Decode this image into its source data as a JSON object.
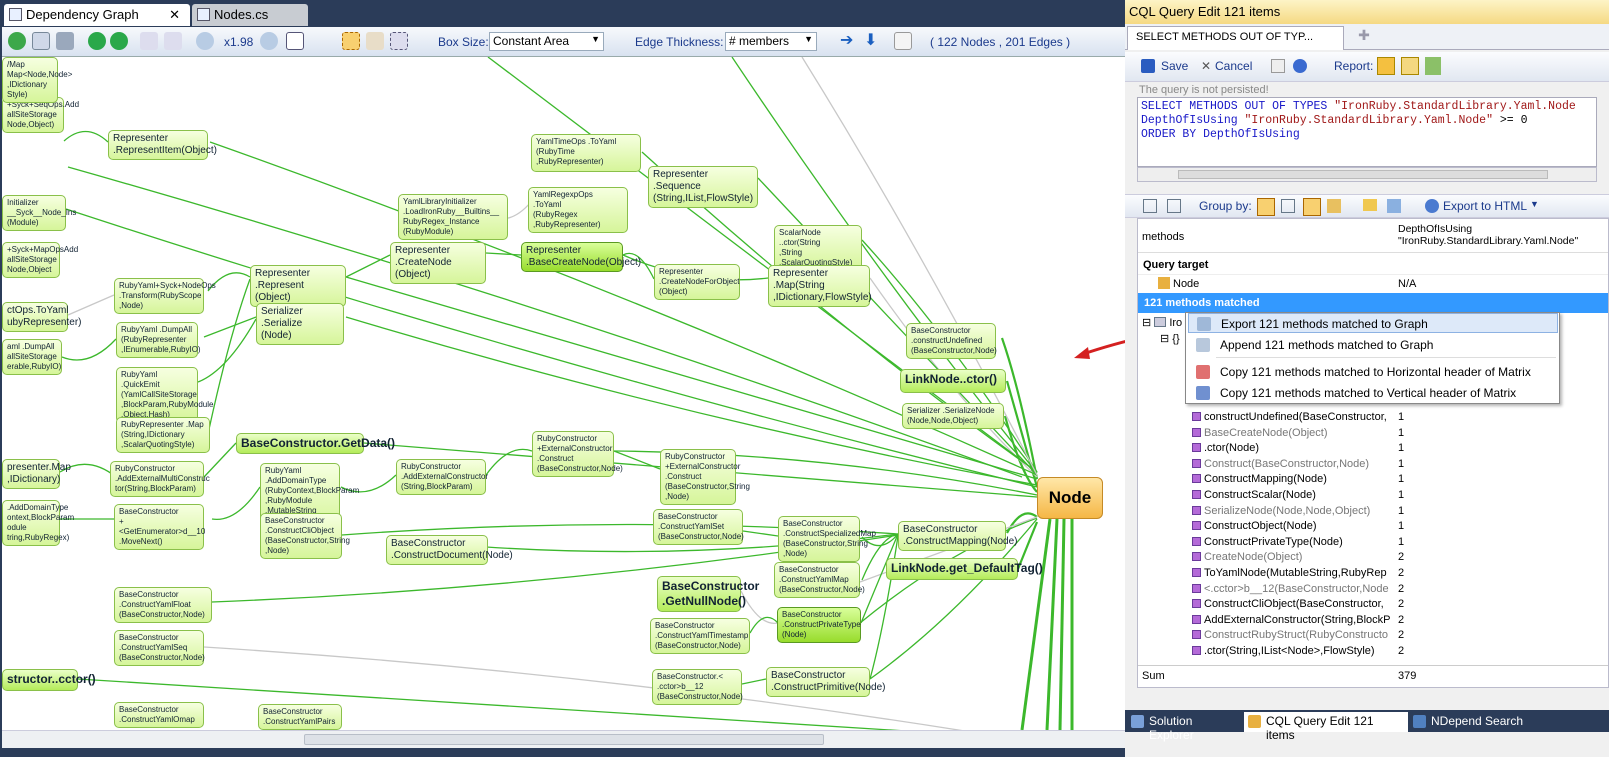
{
  "doc_tabs": {
    "graph": "Dependency Graph",
    "nodes": "Nodes.cs",
    "close": "✕"
  },
  "toolbar": {
    "zoom": "x1.98",
    "box_size_label": "Box Size:",
    "box_size_value": "Constant Area",
    "edge_thickness_label": "Edge Thickness:",
    "edge_thickness_value": "# members",
    "stats": "( 122 Nodes , 201 Edges )"
  },
  "graph": {
    "target_node": "Node",
    "nodes": [
      {
        "label": "Representer\n.RepresentItem(Object)",
        "cls": "mid"
      },
      {
        "label": "YamlTimeOps .ToYaml\n(RubyTime\n,RubyRepresenter)"
      },
      {
        "label": "Representer .Sequence\n(String,IList,FlowStyle)",
        "cls": "mid"
      },
      {
        "label": "YamlRegexpOps .ToYaml\n(RubyRegex\n,RubyRepresenter)"
      },
      {
        "label": "YamlLibraryInitializer\n.LoadIronRuby__Builtins__\nRubyRegex_Instance\n(RubyModule)"
      },
      {
        "label": "ScalarNode ..ctor(String\n,String\n,ScalarQuotingStyle)"
      },
      {
        "label": "Representer .CreateNode\n(Object)",
        "cls": "mid"
      },
      {
        "label": "Representer\n.BaseCreateNode(Object)",
        "cls": "mid sel"
      },
      {
        "label": "Representer\n.CreateNodeForObject\n(Object)"
      },
      {
        "label": "Representer .Map(String\n,IDictionary,FlowStyle)",
        "cls": "mid"
      },
      {
        "label": "Representer .Represent\n(Object)",
        "cls": "mid"
      },
      {
        "label": "RubyYaml+Syck+NodeOps\n.Transform(RubyScope\n,Node)"
      },
      {
        "label": "Serializer .Serialize\n(Node)",
        "cls": "mid"
      },
      {
        "label": "RubyYaml .DumpAll\n(RubyRepresenter\n,IEnumerable,RubyIO)"
      },
      {
        "label": "BaseConstructor\n.constructUndefined\n(BaseConstructor,Node)"
      },
      {
        "label": "LinkNode..ctor()",
        "cls": "big"
      },
      {
        "label": "RubyYaml .QuickEmit\n(YamlCallSiteStorage\n,BlockParam,RubyModule\n,Object,Hash)"
      },
      {
        "label": "Serializer .SerializeNode\n(Node,Node,Object)"
      },
      {
        "label": "RubyRepresenter .Map\n(String,IDictionary\n,ScalarQuotingStyle)"
      },
      {
        "label": "BaseConstructor.GetData()",
        "cls": "big"
      },
      {
        "label": "RubyConstructor\n+ExternalConstructor\n.Construct\n(BaseConstructor,Node)"
      },
      {
        "label": "RubyConstructor\n+ExternalConstructor\n.Construct\n(BaseConstructor,String\n,Node)"
      },
      {
        "label": "RubyConstructor\n.AddExternalMultiConstruc\ntor(String,BlockParam)"
      },
      {
        "label": "RubyYaml .AddDomainType\n(RubyContext,BlockParam\n,RubyModule\n,MutableString\n,MutableString)"
      },
      {
        "label": "RubyConstructor\n.AddExternalConstructor\n(String,BlockParam)"
      },
      {
        "label": "BaseConstructor\n+<GetEnumerator>d__10\n.MoveNext()"
      },
      {
        "label": "BaseConstructor\n.ConstructCliObject\n(BaseConstructor,String\n,Node)"
      },
      {
        "label": "BaseConstructor\n.ConstructDocument(Node)",
        "cls": "mid"
      },
      {
        "label": "BaseConstructor\n.ConstructYamlSet\n(BaseConstructor,Node)"
      },
      {
        "label": "BaseConstructor\n.ConstructSpecializedMap\n(BaseConstructor,String\n,Node)"
      },
      {
        "label": "BaseConstructor\n.ConstructMapping(Node)",
        "cls": "mid"
      },
      {
        "label": "LinkNode.get_DefaultTag()",
        "cls": "big"
      },
      {
        "label": "BaseConstructor\n.ConstructYamlMap\n(BaseConstructor,Node)"
      },
      {
        "label": "BaseConstructor\n.GetNullNode()",
        "cls": "big"
      },
      {
        "label": "BaseConstructor\n.ConstructYamlFloat\n(BaseConstructor,Node)"
      },
      {
        "label": "BaseConstructor\n.ConstructYamlTimestamp\n(BaseConstructor,Node)"
      },
      {
        "label": "BaseConstructor\n.ConstructPrivateType\n(Node)",
        "cls": "sel"
      },
      {
        "label": "BaseConstructor\n.ConstructYamlSeq\n(BaseConstructor,Node)"
      },
      {
        "label": "BaseConstructor.<\n.cctor>b__12\n(BaseConstructor,Node)"
      },
      {
        "label": "BaseConstructor\n.ConstructPrimitive(Node)",
        "cls": "mid"
      },
      {
        "label": "structor..cctor()",
        "cls": "big"
      },
      {
        "label": "ctOps.ToYaml\nubyRepresenter)",
        "cls": "mid"
      },
      {
        "label": "aml .DumpAll\nallSiteStorage\nerable,RubyIO)"
      },
      {
        "label": "presenter.Map\n,IDictionary)",
        "cls": "mid"
      },
      {
        "label": ".AddDomainType\nontext,BlockParam\nodule\ntring,RubyRegex)"
      },
      {
        "label": "+Syck+SeqOps.Add\nallSiteStorage\nNode,Object)"
      },
      {
        "label": "+Syck+MapOpsAdd\nallSiteStorage\nNode,Object"
      },
      {
        "label": "Initializer\n__Syck__Node_Ins\n(Module)"
      },
      {
        "label": "/Map\nMap<Node,Node>\n,IDictionary\nStyle)"
      },
      {
        "label": "BaseConstructor\n.ConstructYamlOmap"
      },
      {
        "label": "BaseConstructor\n.ConstructYamlPairs"
      }
    ]
  },
  "right_panel": {
    "title": "CQL Query Edit  121 items",
    "tab": "SELECT METHODS OUT OF TYP...",
    "save": "Save",
    "cancel": "Cancel",
    "report": "Report:",
    "not_persisted": "The query is not persisted!",
    "query_line1a": "SELECT METHODS OUT OF TYPES ",
    "query_line1b": "\"IronRuby.StandardLibrary.Yaml.Node",
    "query_line2a": "DepthOfIsUsing ",
    "query_line2b": "\"IronRuby.StandardLibrary.Yaml.Node\"",
    "query_line2c": " >= ",
    "query_line2d": "0",
    "query_line3": "ORDER BY DepthOfIsUsing",
    "group_by": "Group by:",
    "export": "Export to HTML",
    "col_methods": "methods",
    "col_depth1": "DepthOfIsUsing",
    "col_depth2": "\"IronRuby.StandardLibrary.Yaml.Node\"",
    "query_target": "Query target",
    "target_node": "Node",
    "target_na": "N/A",
    "matched": "121 methods matched",
    "rows": [
      {
        "name": "constructUndefined(BaseConstructor,",
        "val": "1",
        "gray": false
      },
      {
        "name": "BaseCreateNode(Object)",
        "val": "1",
        "gray": true
      },
      {
        "name": ".ctor(Node)",
        "val": "1",
        "gray": false
      },
      {
        "name": "Construct(BaseConstructor,Node)",
        "val": "1",
        "gray": true
      },
      {
        "name": "ConstructMapping(Node)",
        "val": "1",
        "gray": false
      },
      {
        "name": "ConstructScalar(Node)",
        "val": "1",
        "gray": false
      },
      {
        "name": "SerializeNode(Node,Node,Object)",
        "val": "1",
        "gray": true
      },
      {
        "name": "ConstructObject(Node)",
        "val": "1",
        "gray": false
      },
      {
        "name": "ConstructPrivateType(Node)",
        "val": "1",
        "gray": false
      },
      {
        "name": "CreateNode(Object)",
        "val": "2",
        "gray": true
      },
      {
        "name": "ToYamlNode(MutableString,RubyRep",
        "val": "2",
        "gray": false
      },
      {
        "name": "<.cctor>b__12(BaseConstructor,Node",
        "val": "2",
        "gray": true
      },
      {
        "name": "ConstructCliObject(BaseConstructor,",
        "val": "2",
        "gray": false
      },
      {
        "name": "AddExternalConstructor(String,BlockP",
        "val": "2",
        "gray": false
      },
      {
        "name": "ConstructRubyStruct(RubyConstructo",
        "val": "2",
        "gray": true
      },
      {
        "name": ".ctor(String,IList<Node>,FlowStyle)",
        "val": "2",
        "gray": false
      }
    ],
    "sum_label": "Sum",
    "sum_value": "379",
    "context_menu": [
      "Export 121 methods matched to Graph",
      "Append 121 methods matched to Graph",
      "Copy 121 methods matched to Horizontal header of Matrix",
      "Copy 121 methods matched to Vertical header of Matrix"
    ]
  },
  "bottom_tabs": {
    "solution": "Solution Explorer",
    "cql": "CQL Query Edit  121 items",
    "search": "NDepend Search"
  },
  "colors": {
    "edge": "#3cb82c",
    "edge_gray": "#c8c8c8",
    "target_fill": "#f5b746",
    "arrow": "#d42020"
  }
}
